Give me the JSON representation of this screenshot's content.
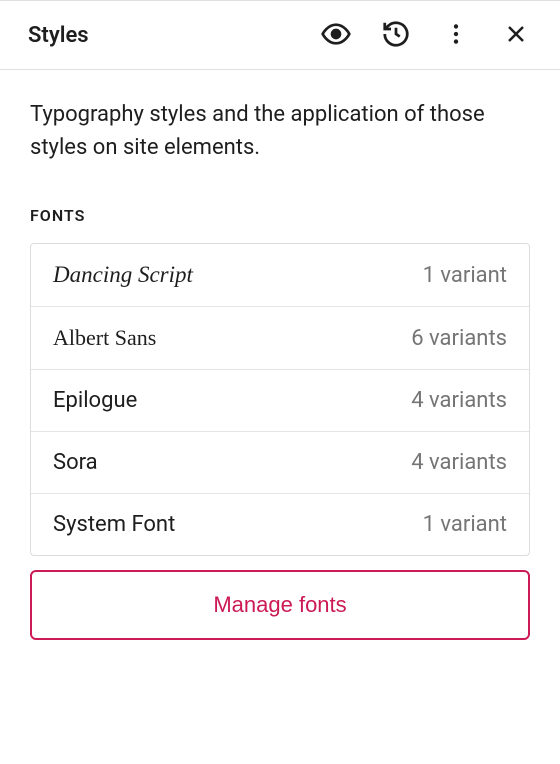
{
  "header": {
    "title": "Styles"
  },
  "description": "Typography styles and the application of those styles on site elements.",
  "section_label": "FONTS",
  "fonts": [
    {
      "name": "Dancing Script",
      "variants": "1 variant"
    },
    {
      "name": "Albert Sans",
      "variants": "6 variants"
    },
    {
      "name": "Epilogue",
      "variants": "4 variants"
    },
    {
      "name": "Sora",
      "variants": "4 variants"
    },
    {
      "name": "System Font",
      "variants": "1 variant"
    }
  ],
  "manage_button": "Manage fonts"
}
